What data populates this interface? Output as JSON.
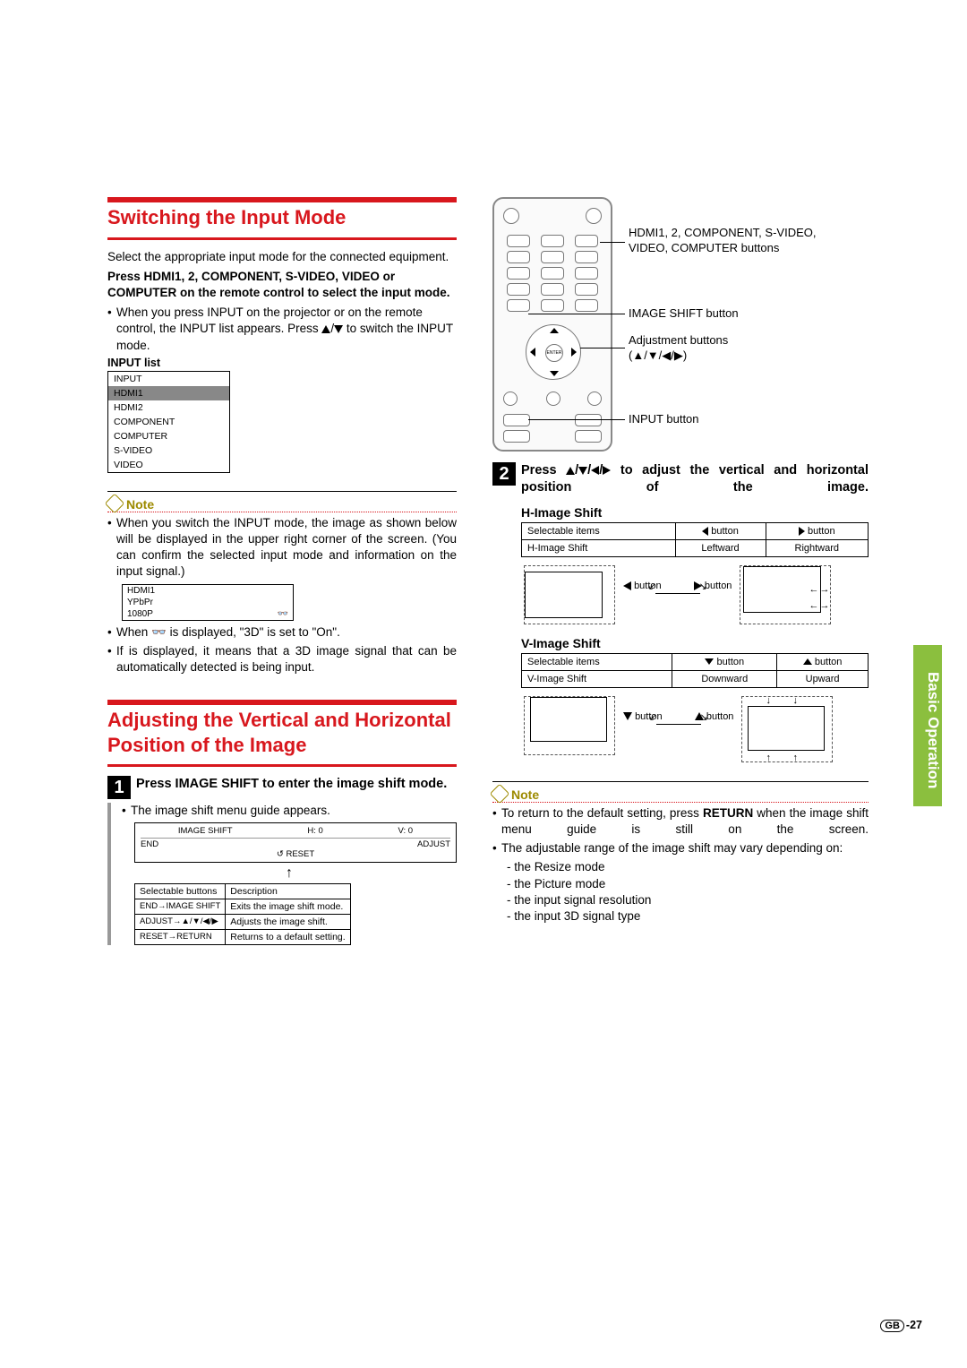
{
  "sideTab": "Basic Operation",
  "pageNum": "-27",
  "pageNumPrefix": "GB",
  "left": {
    "h1": "Switching the Input Mode",
    "intro": "Select the appropriate input mode for the connected equipment.",
    "press_line1": "Press HDMI1, 2, COMPONENT, S-VIDEO, VIDEO or COMPUTER on the remote control to select the input mode.",
    "bullet1a": "When you press INPUT on the projector or on the remote control, the INPUT list appears. Press ",
    "bullet1b": " to switch the INPUT mode.",
    "inputListLabel": "INPUT list",
    "inputList": {
      "header": "INPUT",
      "items": [
        "HDMI1",
        "HDMI2",
        "COMPONENT",
        "COMPUTER",
        "S-VIDEO",
        "VIDEO"
      ]
    },
    "note": "Note",
    "noteBullet1": "When you switch the INPUT mode, the image as shown below will be displayed in the upper right corner of the screen. (You can confirm the selected input mode and information on the input signal.)",
    "miniRow1": "HDMI1",
    "miniRow2": "YPbPr",
    "miniRow3": "1080P",
    "noteBullet2a": "When ",
    "noteBullet2b": " is displayed, \"3D\" is set to \"On\".",
    "noteBullet3": "If       is displayed, it means that a 3D image signal that can be automatically detected is being input.",
    "h2": "Adjusting the Vertical and Horizontal Position of the Image",
    "step1": "Press IMAGE SHIFT to enter the image shift mode.",
    "step1sub": "The image shift menu guide appears.",
    "menuGuide": {
      "title": "IMAGE SHIFT",
      "h": "H: 0",
      "v": "V: 0",
      "row1l": "END",
      "row1r": "ADJUST",
      "row2": "RESET"
    },
    "desc_header1": "Selectable buttons",
    "desc_header2": "Description",
    "desc_rows": [
      {
        "l": "END→IMAGE SHIFT",
        "r": "Exits the image shift mode."
      },
      {
        "l": "ADJUST→▲/▼/◀/▶",
        "r": "Adjusts the image shift."
      },
      {
        "l": "RESET→RETURN",
        "r": "Returns to a default setting."
      }
    ]
  },
  "right": {
    "callout1": "HDMI1, 2, COMPONENT, S-VIDEO, VIDEO, COMPUTER buttons",
    "callout2": "IMAGE SHIFT button",
    "callout3a": "Adjustment buttons",
    "callout3b": "(▲/▼/◀/▶)",
    "callout4": "INPUT button",
    "step2a": "Press ",
    "step2b": " to adjust the vertical and horizontal position of the image.",
    "sub_h": "H-Image Shift",
    "tbl_h_h1": "Selectable items",
    "tbl_h_h2l": "◀ button",
    "tbl_h_h2r": "▶ button",
    "tbl_h_r1": "H-Image Shift",
    "tbl_h_r2l": "Leftward",
    "tbl_h_r2r": "Rightward",
    "diag_h_l": "◀ button",
    "diag_h_r": "▶ button",
    "sub_v": "V-Image Shift",
    "tbl_v_h1": "Selectable items",
    "tbl_v_h2l": "▼ button",
    "tbl_v_h2r": "▲ button",
    "tbl_v_r1": "V-Image Shift",
    "tbl_v_r2l": "Downward",
    "tbl_v_r2r": "Upward",
    "diag_v_l": "▼ button",
    "diag_v_r": "▲ button",
    "note": "Note",
    "noteB1a": "To return to the default setting, press ",
    "noteB1b": "RETURN",
    "noteB1c": " when the image shift menu guide is still on the screen.",
    "noteB2": "The adjustable range of the image shift may vary depending on:",
    "dashes": [
      "- the Resize mode",
      "- the Picture mode",
      "- the input signal resolution",
      "- the input 3D signal type"
    ]
  }
}
